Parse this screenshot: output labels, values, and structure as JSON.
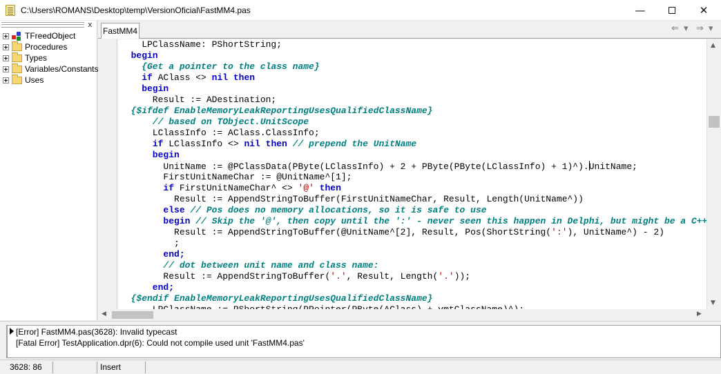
{
  "window": {
    "title": "C:\\Users\\ROMANS\\Desktop\\temp\\VersionOficial\\FastMM4.pas",
    "minimize_glyph": "—",
    "close_glyph": "✕"
  },
  "explorer": {
    "close_glyph": "x",
    "items": [
      {
        "label": "TFreedObject",
        "icon": "class-icon"
      },
      {
        "label": "Procedures",
        "icon": "folder-icon"
      },
      {
        "label": "Types",
        "icon": "folder-icon"
      },
      {
        "label": "Variables/Constants",
        "icon": "folder-icon"
      },
      {
        "label": "Uses",
        "icon": "folder-icon"
      }
    ]
  },
  "tabs": [
    {
      "label": "FastMM4",
      "active": true
    }
  ],
  "nav": {
    "back_glyph": "⇐",
    "back_dropdown_glyph": "▾",
    "forward_glyph": "⇒",
    "forward_dropdown_glyph": "▾"
  },
  "editor": {
    "colors": {
      "keyword": "#0000c8",
      "comment": "#008080",
      "string": "#c00000",
      "plain": "#000000"
    },
    "lines": [
      [
        {
          "t": "    LPClassName: PShortString;",
          "c": "plain"
        }
      ],
      [
        {
          "t": "  begin",
          "c": "keyword"
        }
      ],
      [
        {
          "t": "    {Get a pointer to the class name}",
          "c": "comment"
        }
      ],
      [
        {
          "t": "    ",
          "c": "plain"
        },
        {
          "t": "if",
          "c": "keyword"
        },
        {
          "t": " AClass <> ",
          "c": "plain"
        },
        {
          "t": "nil then",
          "c": "keyword"
        }
      ],
      [
        {
          "t": "    begin",
          "c": "keyword"
        }
      ],
      [
        {
          "t": "      Result := ADestination;",
          "c": "plain"
        }
      ],
      [
        {
          "t": "  {$ifdef EnableMemoryLeakReportingUsesQualifiedClassName}",
          "c": "comment"
        }
      ],
      [
        {
          "t": "      // based on TObject.UnitScope",
          "c": "comment"
        }
      ],
      [
        {
          "t": "      LClassInfo := AClass.ClassInfo;",
          "c": "plain"
        }
      ],
      [
        {
          "t": "      ",
          "c": "plain"
        },
        {
          "t": "if",
          "c": "keyword"
        },
        {
          "t": " LClassInfo <> ",
          "c": "plain"
        },
        {
          "t": "nil then",
          "c": "keyword"
        },
        {
          "t": " // prepend the UnitName",
          "c": "comment"
        }
      ],
      [
        {
          "t": "      begin",
          "c": "keyword"
        }
      ],
      [
        {
          "t": "        UnitName := @PClassData(PByte(LClassInfo) + 2 + PByte(PByte(LClassInfo) + 1)^).",
          "c": "plain"
        },
        {
          "t": "",
          "c": "cursor"
        },
        {
          "t": "UnitName;",
          "c": "plain"
        }
      ],
      [
        {
          "t": "        FirstUnitNameChar := @UnitName^[1];",
          "c": "plain"
        }
      ],
      [
        {
          "t": "        ",
          "c": "plain"
        },
        {
          "t": "if",
          "c": "keyword"
        },
        {
          "t": " FirstUnitNameChar^ <> ",
          "c": "plain"
        },
        {
          "t": "'@'",
          "c": "string"
        },
        {
          "t": " then",
          "c": "keyword"
        }
      ],
      [
        {
          "t": "          Result := AppendStringToBuffer(FirstUnitNameChar, Result, Length(UnitName^))",
          "c": "plain"
        }
      ],
      [
        {
          "t": "        ",
          "c": "plain"
        },
        {
          "t": "else",
          "c": "keyword"
        },
        {
          "t": " // Pos does no memory allocations, so it is safe to use",
          "c": "comment"
        }
      ],
      [
        {
          "t": "        ",
          "c": "plain"
        },
        {
          "t": "begin",
          "c": "keyword"
        },
        {
          "t": " // Skip the '@', then copy until the ':' - never seen this happen in Delphi, but might be a C++",
          "c": "comment"
        }
      ],
      [
        {
          "t": "          Result := AppendStringToBuffer(@UnitName^[2], Result, Pos(ShortString(",
          "c": "plain"
        },
        {
          "t": "':'",
          "c": "string"
        },
        {
          "t": "), UnitName^) - 2)",
          "c": "plain"
        }
      ],
      [
        {
          "t": "          ;",
          "c": "plain"
        }
      ],
      [
        {
          "t": "        end;",
          "c": "keyword"
        }
      ],
      [
        {
          "t": "        // dot between unit name and class name:",
          "c": "comment"
        }
      ],
      [
        {
          "t": "        Result := AppendStringToBuffer(",
          "c": "plain"
        },
        {
          "t": "'.'",
          "c": "string"
        },
        {
          "t": ", Result, Length(",
          "c": "plain"
        },
        {
          "t": "'.'",
          "c": "string"
        },
        {
          "t": "));",
          "c": "plain"
        }
      ],
      [
        {
          "t": "      end;",
          "c": "keyword"
        }
      ],
      [
        {
          "t": "  {$endif EnableMemoryLeakReportingUsesQualifiedClassName}",
          "c": "comment"
        }
      ],
      [
        {
          "t": "      LPClassName := PShortString(PPointer(PByte(AClass) + vmtClassName)^);",
          "c": "plain"
        }
      ]
    ]
  },
  "scroll_glyphs": {
    "up": "▲",
    "down": "▼",
    "left": "◀",
    "right": "▶"
  },
  "messages": [
    "[Error] FastMM4.pas(3628): Invalid typecast",
    "[Fatal Error] TestApplication.dpr(6): Could not compile used unit 'FastMM4.pas'"
  ],
  "status": {
    "position": "3628:  86",
    "modified": "",
    "mode": "Insert"
  }
}
